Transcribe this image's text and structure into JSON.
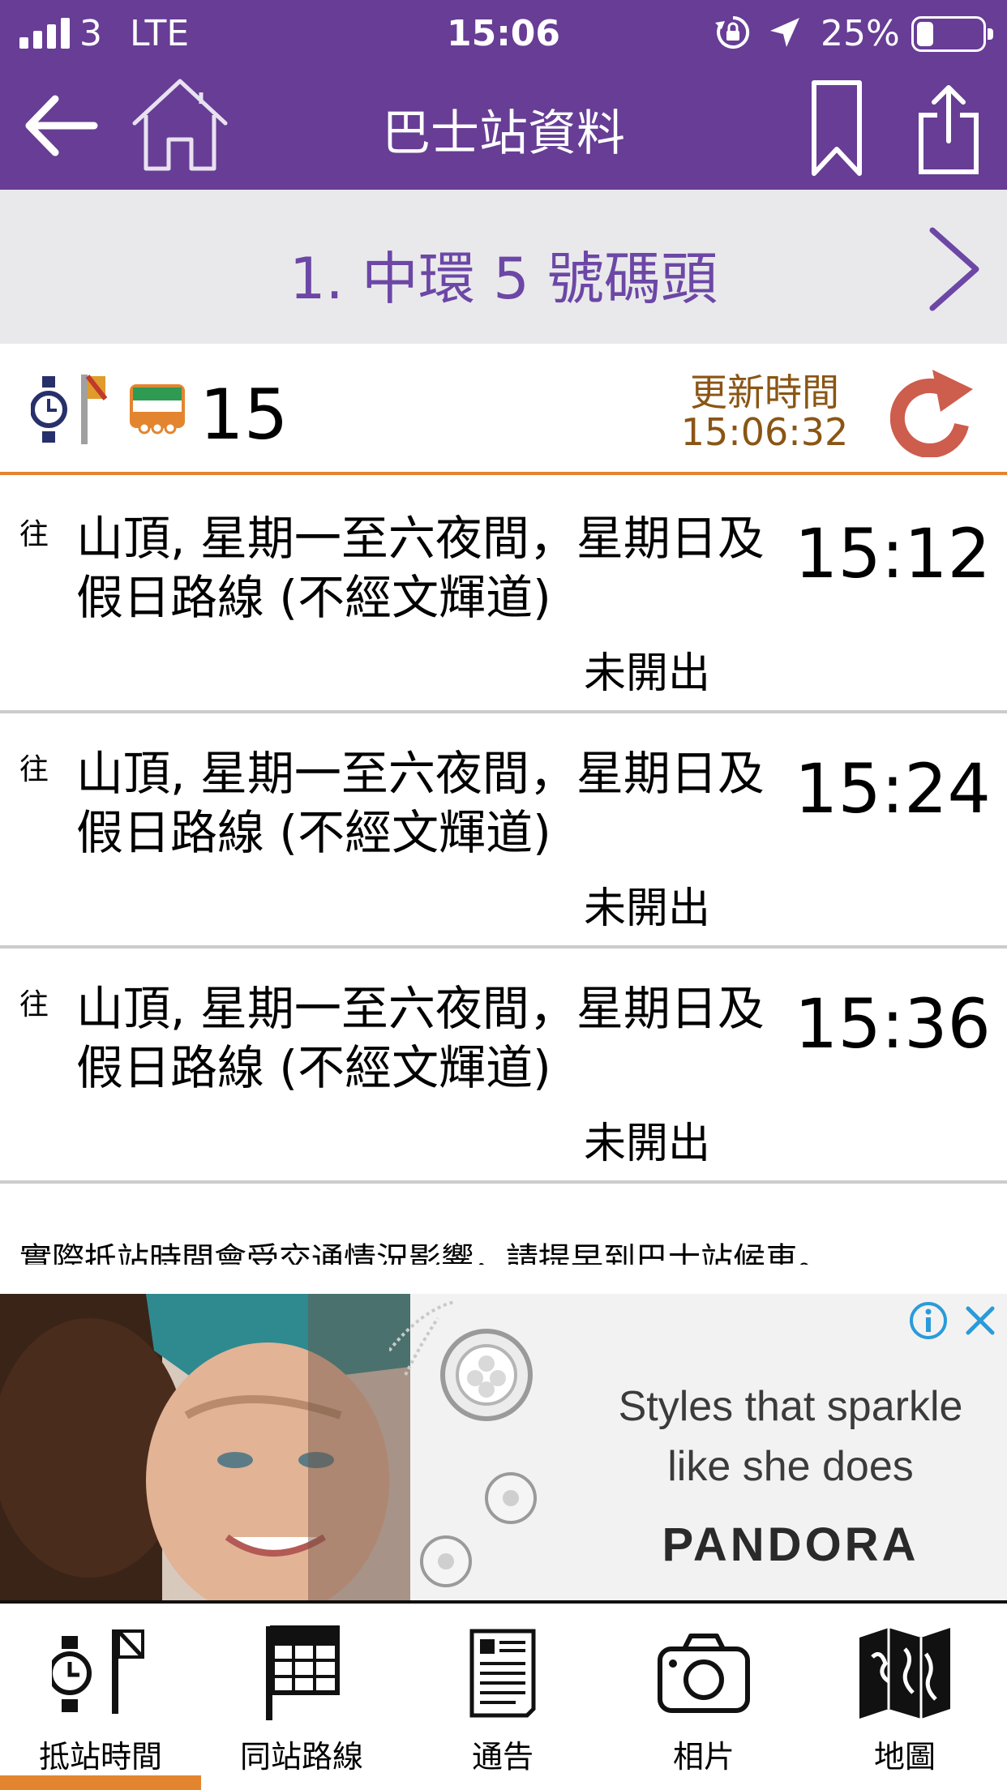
{
  "status_bar": {
    "carrier": "3",
    "network": "LTE",
    "time": "15:06",
    "battery": "25%",
    "battery_level": 0.25
  },
  "nav": {
    "title": "巴士站資料",
    "icons": [
      "back-arrow-icon",
      "home-icon",
      "bookmark-icon",
      "share-icon"
    ]
  },
  "stop": {
    "name": "1. 中環 5 號碼頭",
    "next_icon": "chevron-right-icon"
  },
  "route": {
    "number": "15",
    "update_label": "更新時間",
    "update_time": "15:06:32",
    "refresh_icon": "refresh-icon"
  },
  "arrivals": [
    {
      "to": "往",
      "destination": "山頂, 星期一至六夜間，星期日及假日路線 (不經文輝道)",
      "eta": "15:12",
      "status": "未開出"
    },
    {
      "to": "往",
      "destination": "山頂, 星期一至六夜間，星期日及假日路線 (不經文輝道)",
      "eta": "15:24",
      "status": "未開出"
    },
    {
      "to": "往",
      "destination": "山頂, 星期一至六夜間，星期日及假日路線 (不經文輝道)",
      "eta": "15:36",
      "status": "未開出"
    }
  ],
  "notice": "實際抵站時間會受交通情況影響，請提早到巴士站候車。",
  "ad": {
    "line1": "Styles that sparkle",
    "line2": "like she does",
    "brand": "PANDORA"
  },
  "tabs": [
    {
      "label": "抵站時間",
      "icon": "eta-clock-flag-icon",
      "selected": true
    },
    {
      "label": "同站路線",
      "icon": "route-board-icon",
      "selected": false
    },
    {
      "label": "通告",
      "icon": "notice-document-icon",
      "selected": false
    },
    {
      "label": "相片",
      "icon": "camera-icon",
      "selected": false
    },
    {
      "label": "地圖",
      "icon": "map-icon",
      "selected": false
    }
  ],
  "colors": {
    "header_purple": "#673d95",
    "stop_purple_text": "#6c47a6",
    "accent_orange": "#e3852f",
    "update_brown": "#8a5514",
    "refresh_red": "#cd5d4c"
  }
}
